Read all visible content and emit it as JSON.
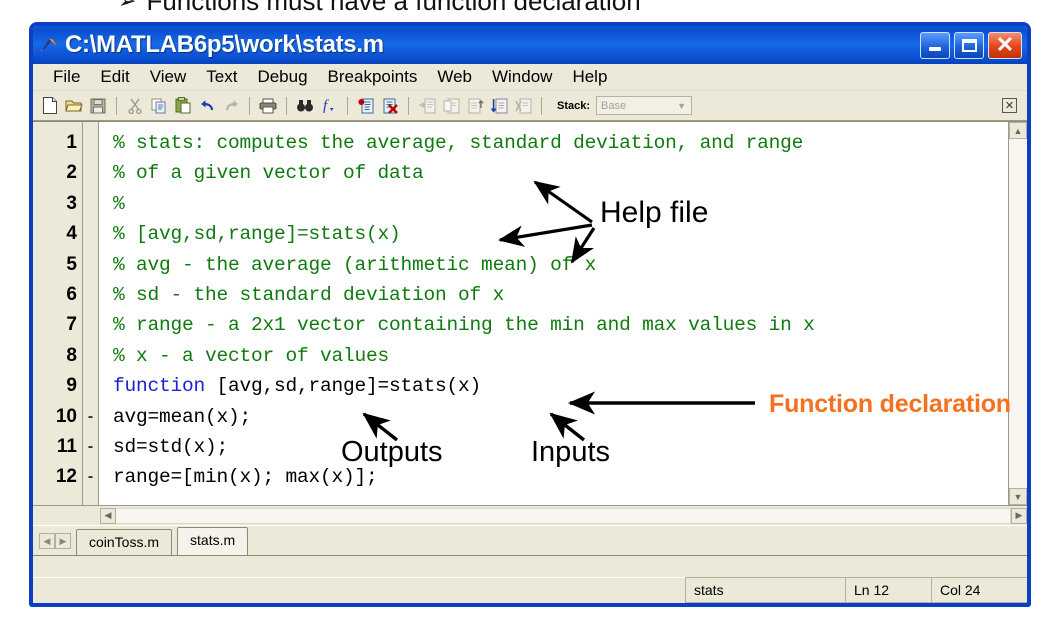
{
  "slide": {
    "bullet_glyph": "➢",
    "headline": "Functions must have a function declaration"
  },
  "window": {
    "title": "C:\\MATLAB6p5\\work\\stats.m",
    "icon": "matlab-membrane-icon",
    "controls": {
      "minimize_label": "_",
      "maximize_label": "□",
      "close_label": "✕"
    }
  },
  "menubar": {
    "items": [
      {
        "label": "File"
      },
      {
        "label": "Edit"
      },
      {
        "label": "View"
      },
      {
        "label": "Text"
      },
      {
        "label": "Debug"
      },
      {
        "label": "Breakpoints"
      },
      {
        "label": "Web"
      },
      {
        "label": "Window"
      },
      {
        "label": "Help"
      }
    ]
  },
  "toolbar": {
    "buttons": [
      {
        "name": "new-file-icon",
        "glyph": "🗋"
      },
      {
        "name": "open-folder-icon",
        "glyph": "📂"
      },
      {
        "name": "save-icon",
        "glyph": "💾"
      },
      {
        "name": "cut-icon",
        "glyph": "✂"
      },
      {
        "name": "copy-icon",
        "glyph": "❐"
      },
      {
        "name": "paste-icon",
        "glyph": "📋"
      },
      {
        "name": "undo-icon",
        "glyph": "↶"
      },
      {
        "name": "redo-icon",
        "glyph": "↷"
      },
      {
        "name": "print-icon",
        "glyph": "🖨"
      },
      {
        "name": "find-icon",
        "glyph": "🔭"
      },
      {
        "name": "function-browser-icon",
        "glyph": "ƒ"
      },
      {
        "name": "set-breakpoint-icon",
        "glyph": "●"
      },
      {
        "name": "clear-breakpoints-icon",
        "glyph": "✕"
      },
      {
        "name": "step-icon",
        "glyph": "→"
      },
      {
        "name": "step-in-icon",
        "glyph": "↓"
      },
      {
        "name": "step-out-icon",
        "glyph": "↑"
      },
      {
        "name": "continue-icon",
        "glyph": "⇓"
      },
      {
        "name": "exit-debug-icon",
        "glyph": "✖"
      }
    ],
    "stack_label": "Stack:",
    "stack_value": "Base",
    "undock_label": "☒"
  },
  "editor": {
    "lines": [
      {
        "num": "1",
        "bp": "",
        "segments": [
          {
            "cls": "cmt",
            "text": "% stats: computes the average, standard deviation, and range"
          }
        ]
      },
      {
        "num": "2",
        "bp": "",
        "segments": [
          {
            "cls": "cmt",
            "text": "% of a given vector of data"
          }
        ]
      },
      {
        "num": "3",
        "bp": "",
        "segments": [
          {
            "cls": "cmt",
            "text": "%"
          }
        ]
      },
      {
        "num": "4",
        "bp": "",
        "segments": [
          {
            "cls": "cmt",
            "text": "% [avg,sd,range]=stats(x)"
          }
        ]
      },
      {
        "num": "5",
        "bp": "",
        "segments": [
          {
            "cls": "cmt",
            "text": "% avg - the average (arithmetic mean) of x"
          }
        ]
      },
      {
        "num": "6",
        "bp": "",
        "segments": [
          {
            "cls": "cmt",
            "text": "% sd - the standard deviation of x"
          }
        ]
      },
      {
        "num": "7",
        "bp": "",
        "segments": [
          {
            "cls": "cmt",
            "text": "% range - a 2x1 vector containing the min and max values in x"
          }
        ]
      },
      {
        "num": "8",
        "bp": "",
        "segments": [
          {
            "cls": "cmt",
            "text": "% x - a vector of values"
          }
        ]
      },
      {
        "num": "9",
        "bp": "",
        "segments": [
          {
            "cls": "kw",
            "text": "function"
          },
          {
            "cls": "pln",
            "text": " [avg,sd,range]=stats(x)"
          }
        ]
      },
      {
        "num": "10",
        "bp": "-",
        "segments": [
          {
            "cls": "pln",
            "text": "avg=mean(x);"
          }
        ]
      },
      {
        "num": "11",
        "bp": "-",
        "segments": [
          {
            "cls": "pln",
            "text": "sd=std(x);"
          }
        ]
      },
      {
        "num": "12",
        "bp": "-",
        "segments": [
          {
            "cls": "pln",
            "text": "range=[min(x); max(x)];"
          }
        ]
      }
    ],
    "vscroll_up": "▲",
    "vscroll_down": "▼",
    "hscroll_left": "◀",
    "hscroll_right": "▶"
  },
  "tabs": {
    "prev_label": "◀",
    "next_label": "▶",
    "items": [
      {
        "label": "coinToss.m",
        "active": false
      },
      {
        "label": "stats.m",
        "active": true
      }
    ]
  },
  "statusbar": {
    "function_name": "stats",
    "line": "Ln 12",
    "column": "Col 24"
  },
  "annotations": {
    "help_file": "Help file",
    "outputs": "Outputs",
    "inputs": "Inputs",
    "function_declaration": "Function declaration"
  },
  "colors": {
    "titlebar_blue": "#0a4ed0",
    "window_border": "#0b3fc4",
    "chrome": "#ece9d8",
    "comment_green": "#0f7a0f",
    "keyword_blue": "#2020d0",
    "annotation_orange": "#f4711f",
    "close_red": "#e2451b"
  }
}
